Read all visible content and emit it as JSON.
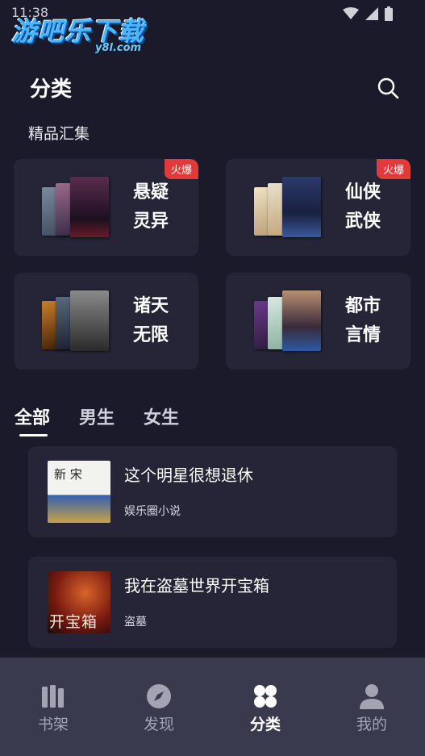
{
  "status": {
    "time": "11:38"
  },
  "watermark": {
    "main": "游吧乐下载",
    "sub": "y8l.com"
  },
  "header": {
    "title": "分类",
    "search_icon": "search-icon"
  },
  "featured": {
    "title": "精品汇集",
    "cards": [
      {
        "line1": "悬疑",
        "line2": "灵异",
        "badge": "火爆"
      },
      {
        "line1": "仙侠",
        "line2": "武侠",
        "badge": "火爆"
      },
      {
        "line1": "诸天",
        "line2": "无限"
      },
      {
        "line1": "都市",
        "line2": "言情"
      }
    ]
  },
  "tabs": [
    {
      "label": "全部"
    },
    {
      "label": "男生"
    },
    {
      "label": "女生"
    }
  ],
  "books": [
    {
      "title": "这个明星很想退休",
      "tag": "娱乐圈小说",
      "cover_text": "新 宋"
    },
    {
      "title": "我在盗墓世界开宝箱",
      "tag": "盗墓",
      "cover_text": "开宝箱"
    }
  ],
  "nav": [
    {
      "label": "书架",
      "icon": "bookshelf-icon"
    },
    {
      "label": "发现",
      "icon": "compass-icon"
    },
    {
      "label": "分类",
      "icon": "grid-icon"
    },
    {
      "label": "我的",
      "icon": "user-icon"
    }
  ],
  "colors": {
    "background": "#1a1a2a",
    "card": "#252537",
    "badge": "#e23a3a",
    "nav_bar": "#3a3a4e"
  }
}
